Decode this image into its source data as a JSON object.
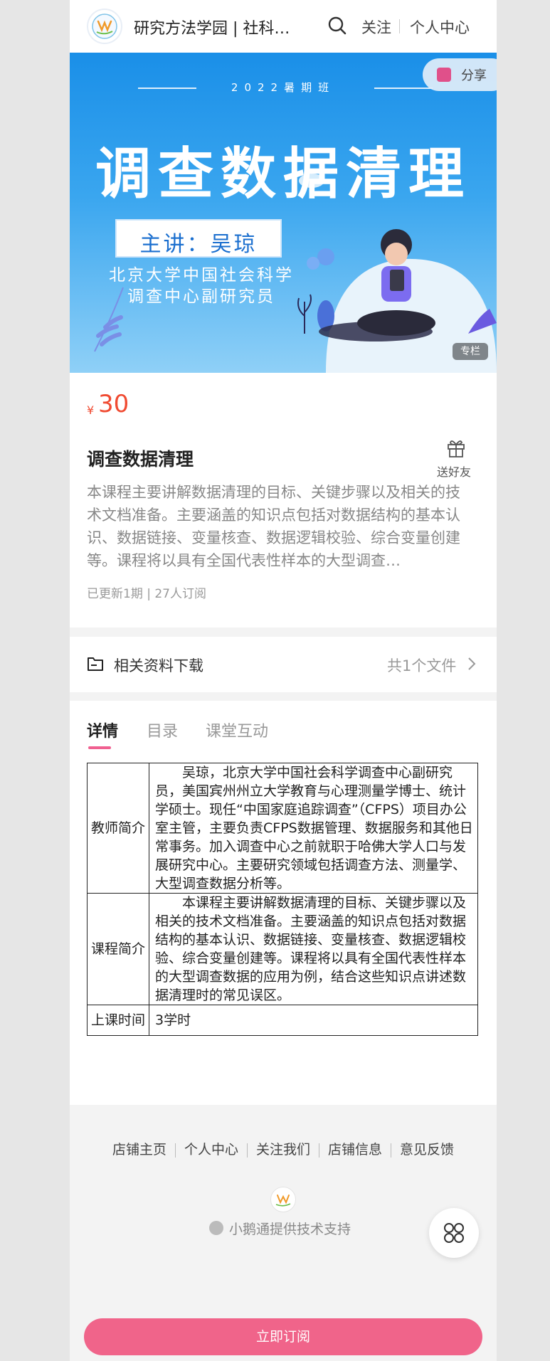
{
  "header": {
    "shop_title": "研究方法学园 | 社科…",
    "follow_label": "关注",
    "personal_center_label": "个人中心"
  },
  "banner": {
    "subtitle": "2022暑期班",
    "title": "调查数据清理",
    "lecturer": "主讲：吴琼",
    "affiliation_line1": "北京大学中国社会科学",
    "affiliation_line2": "调查中心副研究员",
    "share_label": "分享",
    "column_badge": "专栏"
  },
  "course": {
    "currency": "¥",
    "price": "30",
    "title": "调查数据清理",
    "gift_label": "送好友",
    "description": "本课程主要讲解数据清理的目标、关键步骤以及相关的技术文档准备。主要涵盖的知识点包括对数据结构的基本认识、数据链接、变量核查、数据逻辑校验、综合变量创建等。课程将以具有全国代表性样本的大型调查…",
    "meta": "已更新1期 | 27人订阅"
  },
  "resources": {
    "label": "相关资料下载",
    "count": "共1个文件"
  },
  "tabs": [
    {
      "label": "详情"
    },
    {
      "label": "目录"
    },
    {
      "label": "课堂互动"
    }
  ],
  "detail_table": [
    {
      "label": "教师简介",
      "text": "吴琼，北京大学中国社会科学调查中心副研究员，美国宾州州立大学教育与心理测量学博士、统计学硕士。现任“中国家庭追踪调查”（CFPS）项目办公室主管，主要负责CFPS数据管理、数据服务和其他日常事务。加入调查中心之前就职于哈佛大学人口与发展研究中心。主要研究领域包括调查方法、测量学、大型调查数据分析等。"
    },
    {
      "label": "课程简介",
      "text": "本课程主要讲解数据清理的目标、关键步骤以及相关的技术文档准备。主要涵盖的知识点包括对数据结构的基本认识、数据链接、变量核查、数据逻辑校验、综合变量创建等。课程将以具有全国代表性样本的大型调查数据的应用为例，结合这些知识点讲述数据清理时的常见误区。"
    },
    {
      "label": "上课时间",
      "text": "3学时"
    }
  ],
  "footer": {
    "links": [
      "店铺主页",
      "个人中心",
      "关注我们",
      "店铺信息",
      "意见反馈"
    ],
    "support": "小鹅通提供技术支持"
  },
  "subscribe_label": "立即订阅",
  "colors": {
    "accent_pink": "#f0648a",
    "price_red": "#f04b32",
    "banner_blue": "#1a8fe8"
  }
}
